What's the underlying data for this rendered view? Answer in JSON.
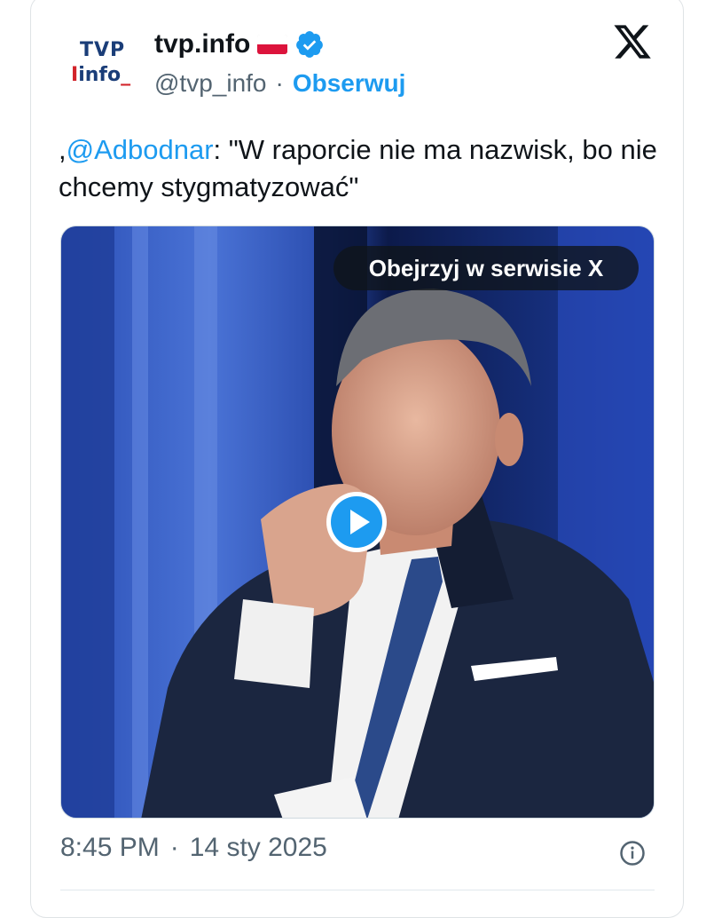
{
  "account": {
    "avatar_line1": "TVP",
    "avatar_line2": "info",
    "display_name": "tvp.info",
    "handle": "@tvp_info",
    "separator": "·",
    "follow_label": "Obserwuj"
  },
  "tweet": {
    "prefix": ",",
    "mention": "@Adbodnar",
    "text": ": \"W raporcie nie ma nazwisk, bo nie chcemy stygmatyzować\""
  },
  "media": {
    "watch_label": "Obejrzyj w serwisie X"
  },
  "meta": {
    "time": "8:45 PM",
    "separator": "·",
    "date": "14 sty 2025"
  },
  "colors": {
    "accent": "#1d9bf0",
    "text_primary": "#0f1419",
    "text_secondary": "#536471",
    "tvp_blue": "#1a3d78",
    "tvp_red": "#d2232a"
  },
  "icons": {
    "verified": "verified-badge-icon",
    "flag": "poland-flag-icon",
    "x_logo": "x-logo-icon",
    "play": "play-icon",
    "info": "info-icon"
  }
}
